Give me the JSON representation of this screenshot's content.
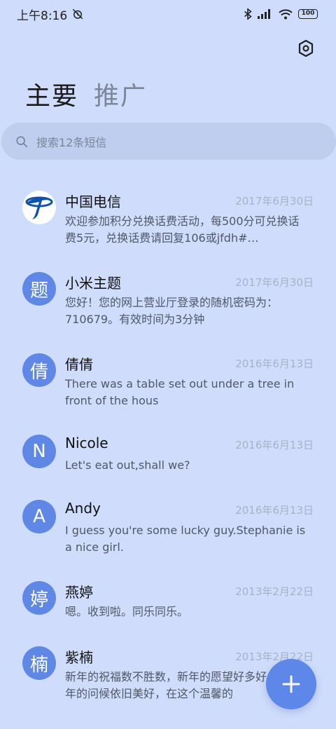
{
  "status_bar": {
    "time": "上午8:16",
    "battery": "100"
  },
  "tabs": [
    {
      "label": "主要"
    },
    {
      "label": "推广"
    }
  ],
  "search": {
    "placeholder": "搜索12条短信"
  },
  "messages": [
    {
      "sender": "中国电信",
      "avatar": "",
      "date": "2017年6月30日",
      "preview": "欢迎参加积分兑换话费活动，每500分可兑换话费5元，兑换话费请回复106或jfdh#…"
    },
    {
      "sender": "小米主题",
      "avatar": "题",
      "date": "2017年6月30日",
      "preview": "您好！您的网上营业厅登录的随机密码为：710679。有效时间为3分钟"
    },
    {
      "sender": "倩倩",
      "avatar": "倩",
      "date": "2016年6月13日",
      "preview": "There was a table set out under a tree in front of the hous"
    },
    {
      "sender": "Nicole",
      "avatar": "N",
      "date": "2016年6月13日",
      "preview": "Let's eat out,shall we?"
    },
    {
      "sender": "Andy",
      "avatar": "A",
      "date": "2016年6月13日",
      "preview": "I guess you're some lucky guy.Stephanie is a nice girl."
    },
    {
      "sender": "燕婷",
      "avatar": "婷",
      "date": "2013年2月22日",
      "preview": "嗯。收到啦。同乐同乐。"
    },
    {
      "sender": "紫楠",
      "avatar": "楠",
      "date": "2013年2月22日",
      "preview": "新年的祝福数不胜数，新年的愿望好多好多，新年的问候依旧美好，在这个温馨的"
    }
  ],
  "colors": {
    "background": "#cfdcfb",
    "accent": "#5f88e6",
    "search_bg": "#bfcdee"
  }
}
